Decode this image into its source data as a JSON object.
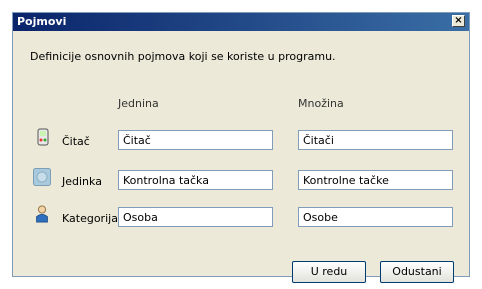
{
  "window": {
    "title": "Pojmovi",
    "close": "×"
  },
  "description": "Definicije osnovnih pojmova koji se koriste u programu.",
  "columns": {
    "singular": "Jednina",
    "plural": "Množina"
  },
  "rows": [
    {
      "label": "Čitač",
      "icon": "reader-icon",
      "singular": "Čitač",
      "plural": "Čitači"
    },
    {
      "label": "Jedinka",
      "icon": "unit-icon",
      "singular": "Kontrolna tačka",
      "plural": "Kontrolne tačke"
    },
    {
      "label": "Kategorija",
      "icon": "person-icon",
      "singular": "Osoba",
      "plural": "Osobe"
    }
  ],
  "buttons": {
    "ok": "U redu",
    "cancel": "Odustani"
  }
}
